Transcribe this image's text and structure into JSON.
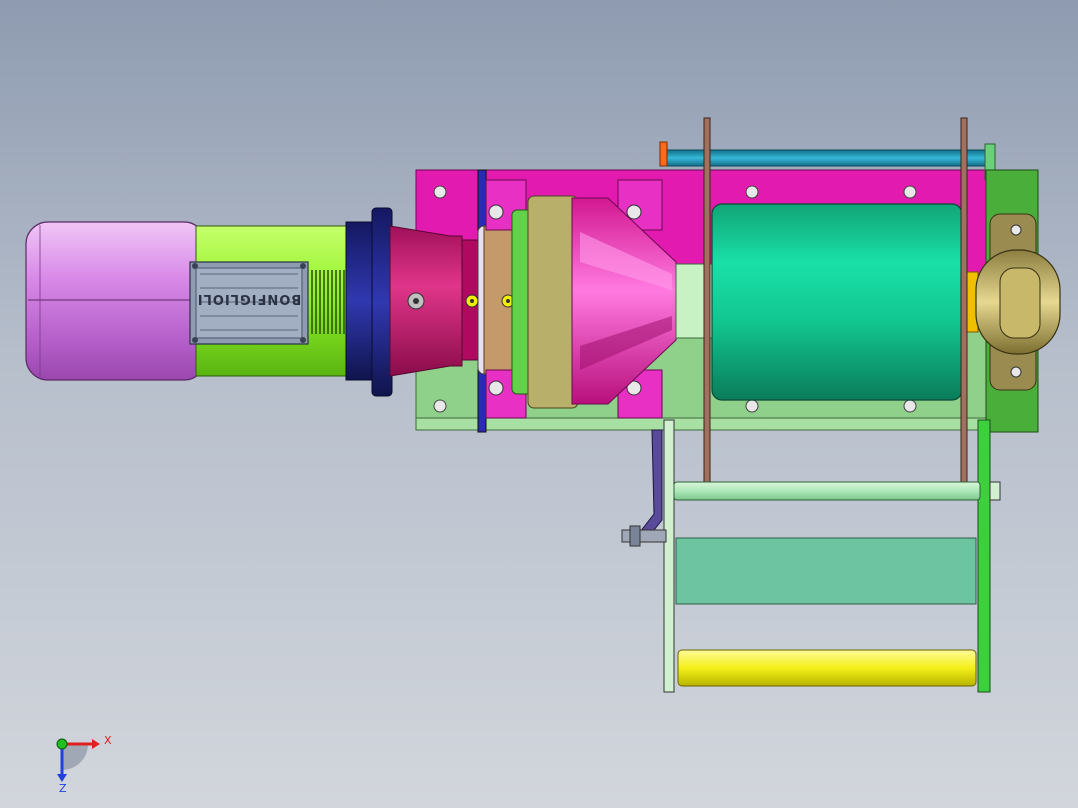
{
  "viewport": {
    "background_top": "#8e9bb0",
    "background_bottom": "#d2d6dc"
  },
  "model": {
    "motor_nameplate": "BONFIGLIOLI",
    "components": [
      "motor-housing",
      "motor-terminal-box",
      "motor-flange",
      "gearbox",
      "brake-disc",
      "gear-coupling",
      "cable-drum",
      "pillow-block-bearing",
      "base-frame",
      "top-rod",
      "rope-guide-frame",
      "guide-plate",
      "yellow-roller"
    ],
    "colors": {
      "motor": "#cf7fe0",
      "motor_fins": "#8df026",
      "frame_top": "#e21ab0",
      "frame_bottom": "#8fd08a",
      "drum": "#14c896",
      "rod": "#1b90b0",
      "roller": "#f4f018",
      "bearing": "#c7b86a"
    }
  },
  "triad": {
    "x_label": "X",
    "z_label": "Z",
    "x_color": "#e02020",
    "y_color": "#20c020",
    "z_color": "#2040e0"
  }
}
